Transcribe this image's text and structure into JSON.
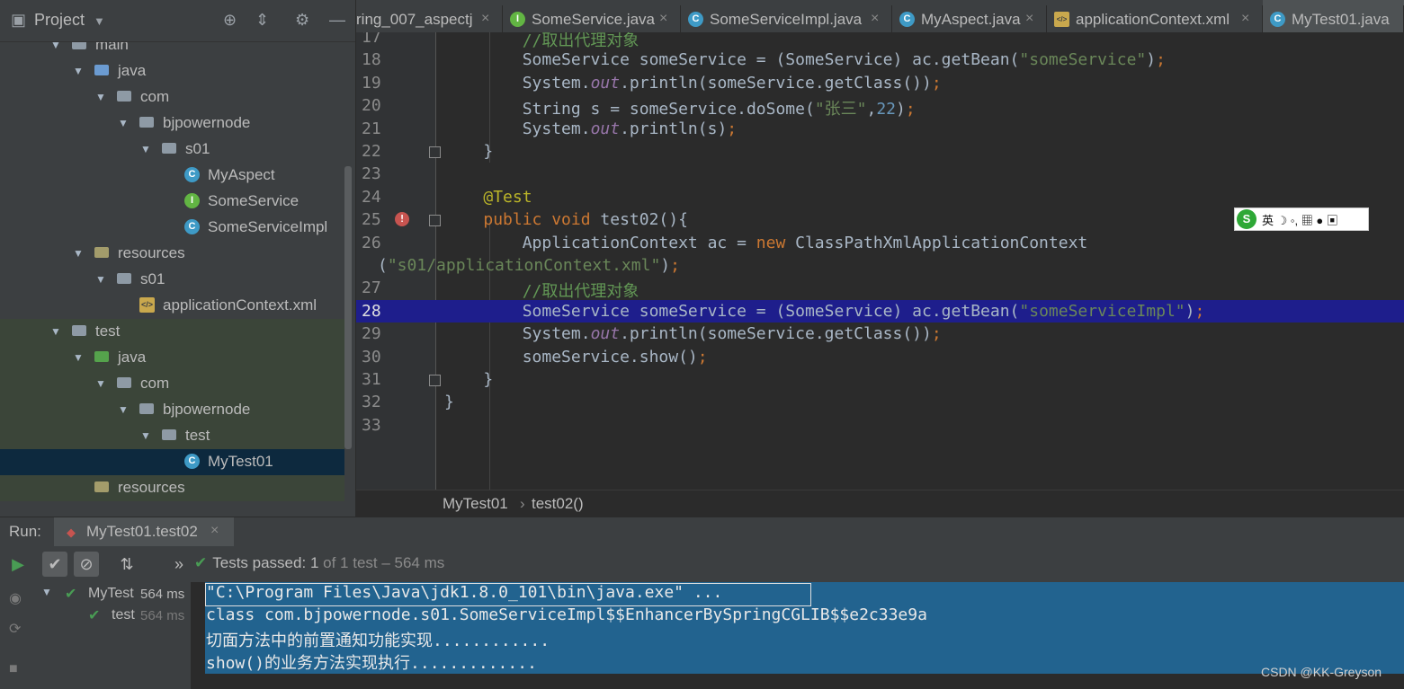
{
  "project_panel": {
    "title": "Project",
    "tree": [
      {
        "label": "main",
        "indent": 0,
        "kind": "dir",
        "expanded": true
      },
      {
        "label": "java",
        "indent": 1,
        "kind": "src",
        "expanded": true
      },
      {
        "label": "com",
        "indent": 2,
        "kind": "dir",
        "expanded": true
      },
      {
        "label": "bjpowernode",
        "indent": 3,
        "kind": "dir",
        "expanded": true
      },
      {
        "label": "s01",
        "indent": 4,
        "kind": "dir",
        "expanded": true
      },
      {
        "label": "MyAspect",
        "indent": 5,
        "kind": "class"
      },
      {
        "label": "SomeService",
        "indent": 5,
        "kind": "interface"
      },
      {
        "label": "SomeServiceImpl",
        "indent": 5,
        "kind": "class"
      },
      {
        "label": "resources",
        "indent": 1,
        "kind": "res",
        "expanded": true
      },
      {
        "label": "s01",
        "indent": 2,
        "kind": "dir",
        "expanded": true
      },
      {
        "label": "applicationContext.xml",
        "indent": 3,
        "kind": "xml"
      },
      {
        "label": "test",
        "indent": 0,
        "kind": "dir",
        "expanded": true
      },
      {
        "label": "java",
        "indent": 1,
        "kind": "tst",
        "expanded": true
      },
      {
        "label": "com",
        "indent": 2,
        "kind": "dir",
        "expanded": true
      },
      {
        "label": "bjpowernode",
        "indent": 3,
        "kind": "dir",
        "expanded": true
      },
      {
        "label": "test",
        "indent": 4,
        "kind": "dir",
        "expanded": true
      },
      {
        "label": "MyTest01",
        "indent": 5,
        "kind": "class",
        "selected": true
      },
      {
        "label": "resources",
        "indent": 1,
        "kind": "res"
      }
    ]
  },
  "tabs": [
    {
      "label": "ring_007_aspectj",
      "icon": ""
    },
    {
      "label": "SomeService.java",
      "icon": "I"
    },
    {
      "label": "SomeServiceImpl.java",
      "icon": "C"
    },
    {
      "label": "MyAspect.java",
      "icon": "C"
    },
    {
      "label": "applicationContext.xml",
      "icon": "xml"
    },
    {
      "label": "MyTest01.java",
      "icon": "C",
      "active": true
    }
  ],
  "editor": {
    "lines": [
      {
        "n": "17",
        "html": "        <span class='cmt'>//取出代理对象</span>"
      },
      {
        "n": "18",
        "html": "        SomeService someService = (SomeService) ac.getBean(<span class='str'>\"someService\"</span>)<span class='kw'>;</span>"
      },
      {
        "n": "19",
        "html": "        System.<span class='fld'>out</span>.println(someService.getClass())<span class='kw'>;</span>"
      },
      {
        "n": "20",
        "html": "        String s = someService.doSome(<span class='str'>\"张三\"</span>,<span class='num'>22</span>)<span class='kw'>;</span>"
      },
      {
        "n": "21",
        "html": "        System.<span class='fld'>out</span>.println(s)<span class='kw'>;</span>"
      },
      {
        "n": "22",
        "html": "    }"
      },
      {
        "n": "23",
        "html": ""
      },
      {
        "n": "24",
        "html": "    <span class='ann'>@Test</span>"
      },
      {
        "n": "25",
        "html": "    <span class='kw'>public void</span> test02(){"
      },
      {
        "n": "26",
        "html": "        ApplicationContext ac = <span class='kw'>new</span> ClassPathXmlApplicationContext"
      },
      {
        "n": "",
        "html": "<span style='position:relative;left:-74px'>(<span class='str'>\"s01/applicationContext.xml\"</span>)<span class='kw'>;</span></span>"
      },
      {
        "n": "27",
        "html": "        <span class='cmt'>//取出代理对象</span>"
      },
      {
        "n": "28",
        "html": "        SomeService someService = (SomeService) ac.getBean(<span class='str'>\"someServiceImpl\"</span>)<span class='kw'>;</span>",
        "highlight": true
      },
      {
        "n": "29",
        "html": "        System.<span class='fld'>out</span>.println(someService.getClass())<span class='kw'>;</span>"
      },
      {
        "n": "30",
        "html": "        someService.show()<span class='kw'>;</span>"
      },
      {
        "n": "31",
        "html": "    }"
      },
      {
        "n": "32",
        "html": "}"
      },
      {
        "n": "33",
        "html": ""
      }
    ]
  },
  "ime_bar": {
    "text": "英 ☽ ◦, ▦ ● ▣"
  },
  "breadcrumb": {
    "class_name": "MyTest01",
    "sep": "›",
    "method": "test02()"
  },
  "run_panel": {
    "label": "Run:",
    "tab_title": "MyTest01.test02",
    "status": {
      "prefix": "Tests passed:",
      "count": "1",
      "suffix": "of 1 test – 564 ms"
    },
    "test_tree": [
      {
        "name": "MyTest",
        "time": "564 ms"
      },
      {
        "name": "test",
        "time": "564 ms"
      }
    ],
    "console": [
      "\"C:\\Program Files\\Java\\jdk1.8.0_101\\bin\\java.exe\" ...",
      "class com.bjpowernode.s01.SomeServiceImpl$$EnhancerBySpringCGLIB$$e2c33e9a",
      "切面方法中的前置通知功能实现............",
      "show()的业务方法实现执行............."
    ]
  },
  "watermark": "CSDN @KK-Greyson"
}
